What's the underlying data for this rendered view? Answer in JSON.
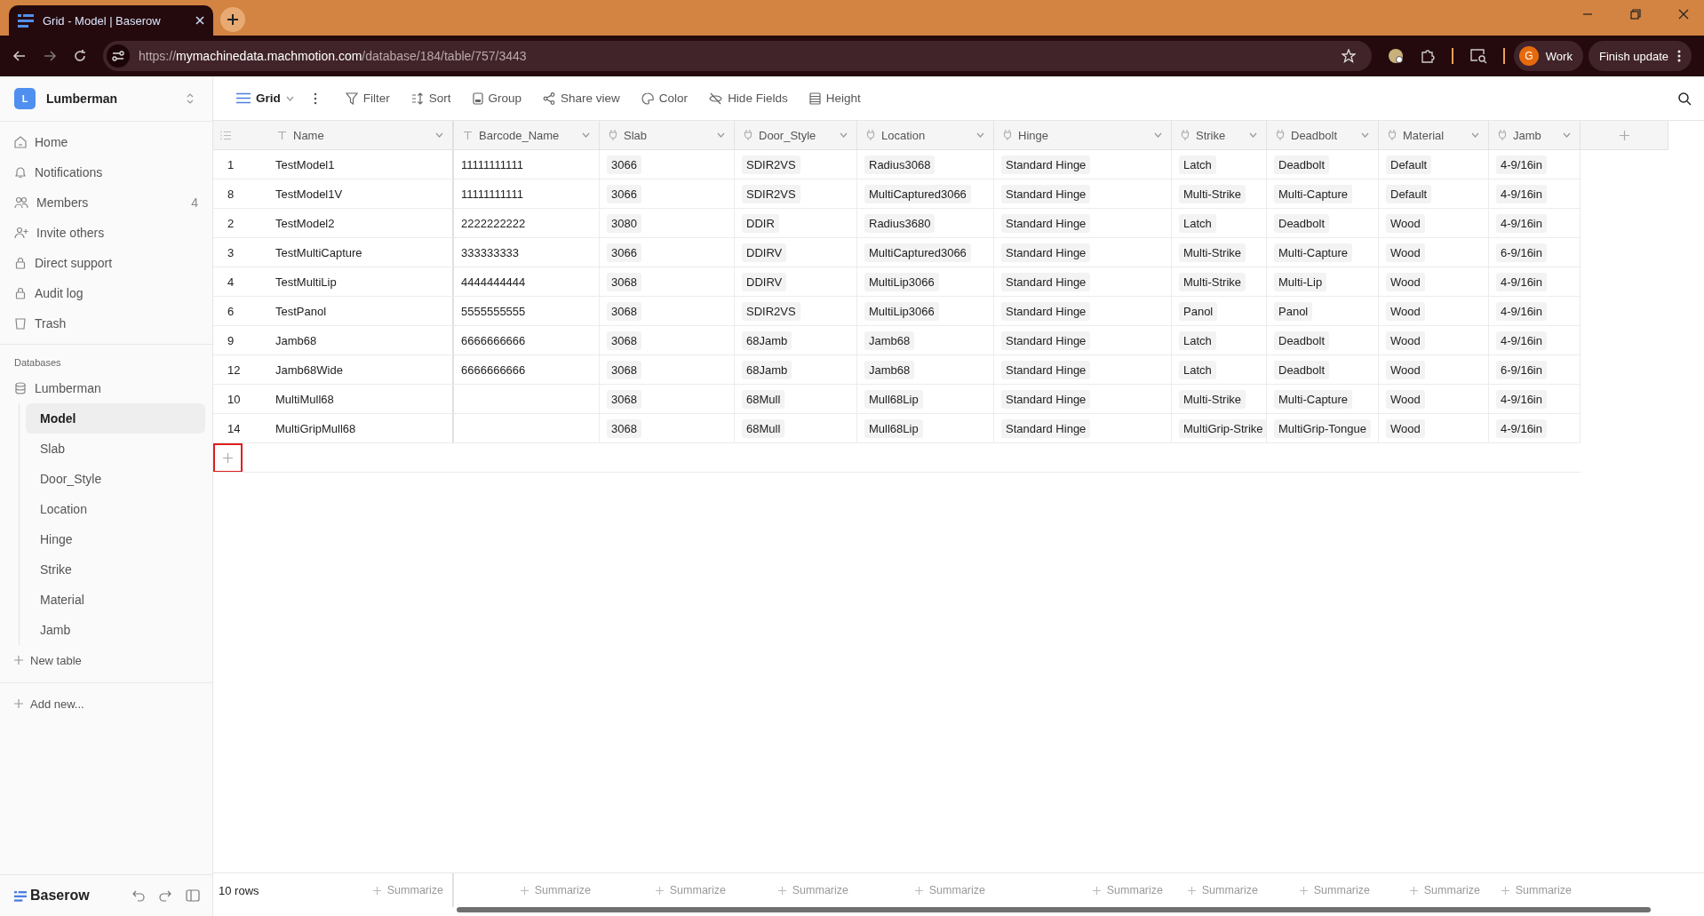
{
  "browser": {
    "tab_title": "Grid - Model | Baserow",
    "url_host": "mymachinedata.machmotion.com",
    "url_prefix": "https://",
    "url_path": "/database/184/table/757/3443",
    "profile": {
      "initial": "G",
      "label": "Work"
    },
    "update_button": "Finish update"
  },
  "sidebar": {
    "workspace": {
      "initial": "L",
      "name": "Lumberman"
    },
    "nav": [
      {
        "kind": "home",
        "label": "Home"
      },
      {
        "kind": "bell",
        "label": "Notifications"
      },
      {
        "kind": "members",
        "label": "Members",
        "count": "4"
      },
      {
        "kind": "invite",
        "label": "Invite others"
      },
      {
        "kind": "lock",
        "label": "Direct support"
      },
      {
        "kind": "lock",
        "label": "Audit log"
      },
      {
        "kind": "trash",
        "label": "Trash"
      }
    ],
    "databases_heading": "Databases",
    "database": {
      "name": "Lumberman",
      "tables": [
        {
          "label": "Model",
          "selected": true
        },
        {
          "label": "Slab",
          "selected": false
        },
        {
          "label": "Door_Style",
          "selected": false
        },
        {
          "label": "Location",
          "selected": false
        },
        {
          "label": "Hinge",
          "selected": false
        },
        {
          "label": "Strike",
          "selected": false
        },
        {
          "label": "Material",
          "selected": false
        },
        {
          "label": "Jamb",
          "selected": false
        }
      ]
    },
    "new_table": "New table",
    "add_new": "Add new...",
    "logo": "Baserow"
  },
  "toolbar": {
    "view": "Grid",
    "actions": [
      {
        "kind": "filter",
        "label": "Filter"
      },
      {
        "kind": "sort",
        "label": "Sort"
      },
      {
        "kind": "group",
        "label": "Group"
      },
      {
        "kind": "share",
        "label": "Share view"
      },
      {
        "kind": "color",
        "label": "Color"
      },
      {
        "kind": "hide",
        "label": "Hide Fields"
      },
      {
        "kind": "height",
        "label": "Height"
      }
    ]
  },
  "table": {
    "columns": [
      {
        "name": "Name",
        "kind": "text"
      },
      {
        "name": "Barcode_Name",
        "kind": "text"
      },
      {
        "name": "Slab",
        "kind": "link"
      },
      {
        "name": "Door_Style",
        "kind": "link"
      },
      {
        "name": "Location",
        "kind": "link"
      },
      {
        "name": "Hinge",
        "kind": "link"
      },
      {
        "name": "Strike",
        "kind": "link"
      },
      {
        "name": "Deadbolt",
        "kind": "link"
      },
      {
        "name": "Material",
        "kind": "link"
      },
      {
        "name": "Jamb",
        "kind": "link"
      }
    ],
    "rows": [
      {
        "id": "1",
        "cells": [
          "TestModel1",
          "11111111111",
          "3066",
          "SDIR2VS",
          "Radius3068",
          "Standard Hinge",
          "Latch",
          "Deadbolt",
          "Default",
          "4-9/16in"
        ]
      },
      {
        "id": "8",
        "cells": [
          "TestModel1V",
          "11111111111",
          "3066",
          "SDIR2VS",
          "MultiCaptured3066",
          "Standard Hinge",
          "Multi-Strike",
          "Multi-Capture",
          "Default",
          "4-9/16in"
        ]
      },
      {
        "id": "2",
        "cells": [
          "TestModel2",
          "2222222222",
          "3080",
          "DDIR",
          "Radius3680",
          "Standard Hinge",
          "Latch",
          "Deadbolt",
          "Wood",
          "4-9/16in"
        ]
      },
      {
        "id": "3",
        "cells": [
          "TestMultiCapture",
          "333333333",
          "3066",
          "DDIRV",
          "MultiCaptured3066",
          "Standard Hinge",
          "Multi-Strike",
          "Multi-Capture",
          "Wood",
          "6-9/16in"
        ]
      },
      {
        "id": "4",
        "cells": [
          "TestMultiLip",
          "4444444444",
          "3068",
          "DDIRV",
          "MultiLip3066",
          "Standard Hinge",
          "Multi-Strike",
          "Multi-Lip",
          "Wood",
          "4-9/16in"
        ]
      },
      {
        "id": "6",
        "cells": [
          "TestPanol",
          "5555555555",
          "3068",
          "SDIR2VS",
          "MultiLip3066",
          "Standard Hinge",
          "Panol",
          "Panol",
          "Wood",
          "4-9/16in"
        ]
      },
      {
        "id": "9",
        "cells": [
          "Jamb68",
          "6666666666",
          "3068",
          "68Jamb",
          "Jamb68",
          "Standard Hinge",
          "Latch",
          "Deadbolt",
          "Wood",
          "4-9/16in"
        ]
      },
      {
        "id": "12",
        "cells": [
          "Jamb68Wide",
          "6666666666",
          "3068",
          "68Jamb",
          "Jamb68",
          "Standard Hinge",
          "Latch",
          "Deadbolt",
          "Wood",
          "6-9/16in"
        ]
      },
      {
        "id": "10",
        "cells": [
          "MultiMull68",
          null,
          "3068",
          "68Mull",
          "Mull68Lip",
          "Standard Hinge",
          "Multi-Strike",
          "Multi-Capture",
          "Wood",
          "4-9/16in"
        ]
      },
      {
        "id": "14",
        "cells": [
          "MultiGripMull68",
          null,
          "3068",
          "68Mull",
          "Mull68Lip",
          "Standard Hinge",
          "MultiGrip-Strike",
          "MultiGrip-Tongue",
          "Wood",
          "4-9/16in"
        ]
      }
    ],
    "add_row": {
      "highlighted": true
    },
    "row_count": "10 rows",
    "summaries": [
      "Summarize",
      "Summarize",
      "Summarize",
      "Summarize",
      "Summarize",
      "Summarize",
      "Summarize",
      "Summarize",
      "Summarize",
      "Summarize"
    ]
  }
}
